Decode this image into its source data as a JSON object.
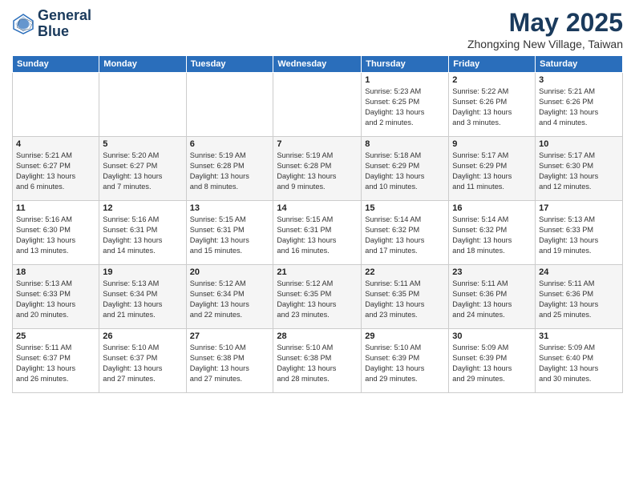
{
  "header": {
    "logo_line1": "General",
    "logo_line2": "Blue",
    "title": "May 2025",
    "subtitle": "Zhongxing New Village, Taiwan"
  },
  "weekdays": [
    "Sunday",
    "Monday",
    "Tuesday",
    "Wednesday",
    "Thursday",
    "Friday",
    "Saturday"
  ],
  "weeks": [
    [
      {
        "day": "",
        "content": ""
      },
      {
        "day": "",
        "content": ""
      },
      {
        "day": "",
        "content": ""
      },
      {
        "day": "",
        "content": ""
      },
      {
        "day": "1",
        "content": "Sunrise: 5:23 AM\nSunset: 6:25 PM\nDaylight: 13 hours\nand 2 minutes."
      },
      {
        "day": "2",
        "content": "Sunrise: 5:22 AM\nSunset: 6:26 PM\nDaylight: 13 hours\nand 3 minutes."
      },
      {
        "day": "3",
        "content": "Sunrise: 5:21 AM\nSunset: 6:26 PM\nDaylight: 13 hours\nand 4 minutes."
      }
    ],
    [
      {
        "day": "4",
        "content": "Sunrise: 5:21 AM\nSunset: 6:27 PM\nDaylight: 13 hours\nand 6 minutes."
      },
      {
        "day": "5",
        "content": "Sunrise: 5:20 AM\nSunset: 6:27 PM\nDaylight: 13 hours\nand 7 minutes."
      },
      {
        "day": "6",
        "content": "Sunrise: 5:19 AM\nSunset: 6:28 PM\nDaylight: 13 hours\nand 8 minutes."
      },
      {
        "day": "7",
        "content": "Sunrise: 5:19 AM\nSunset: 6:28 PM\nDaylight: 13 hours\nand 9 minutes."
      },
      {
        "day": "8",
        "content": "Sunrise: 5:18 AM\nSunset: 6:29 PM\nDaylight: 13 hours\nand 10 minutes."
      },
      {
        "day": "9",
        "content": "Sunrise: 5:17 AM\nSunset: 6:29 PM\nDaylight: 13 hours\nand 11 minutes."
      },
      {
        "day": "10",
        "content": "Sunrise: 5:17 AM\nSunset: 6:30 PM\nDaylight: 13 hours\nand 12 minutes."
      }
    ],
    [
      {
        "day": "11",
        "content": "Sunrise: 5:16 AM\nSunset: 6:30 PM\nDaylight: 13 hours\nand 13 minutes."
      },
      {
        "day": "12",
        "content": "Sunrise: 5:16 AM\nSunset: 6:31 PM\nDaylight: 13 hours\nand 14 minutes."
      },
      {
        "day": "13",
        "content": "Sunrise: 5:15 AM\nSunset: 6:31 PM\nDaylight: 13 hours\nand 15 minutes."
      },
      {
        "day": "14",
        "content": "Sunrise: 5:15 AM\nSunset: 6:31 PM\nDaylight: 13 hours\nand 16 minutes."
      },
      {
        "day": "15",
        "content": "Sunrise: 5:14 AM\nSunset: 6:32 PM\nDaylight: 13 hours\nand 17 minutes."
      },
      {
        "day": "16",
        "content": "Sunrise: 5:14 AM\nSunset: 6:32 PM\nDaylight: 13 hours\nand 18 minutes."
      },
      {
        "day": "17",
        "content": "Sunrise: 5:13 AM\nSunset: 6:33 PM\nDaylight: 13 hours\nand 19 minutes."
      }
    ],
    [
      {
        "day": "18",
        "content": "Sunrise: 5:13 AM\nSunset: 6:33 PM\nDaylight: 13 hours\nand 20 minutes."
      },
      {
        "day": "19",
        "content": "Sunrise: 5:13 AM\nSunset: 6:34 PM\nDaylight: 13 hours\nand 21 minutes."
      },
      {
        "day": "20",
        "content": "Sunrise: 5:12 AM\nSunset: 6:34 PM\nDaylight: 13 hours\nand 22 minutes."
      },
      {
        "day": "21",
        "content": "Sunrise: 5:12 AM\nSunset: 6:35 PM\nDaylight: 13 hours\nand 23 minutes."
      },
      {
        "day": "22",
        "content": "Sunrise: 5:11 AM\nSunset: 6:35 PM\nDaylight: 13 hours\nand 23 minutes."
      },
      {
        "day": "23",
        "content": "Sunrise: 5:11 AM\nSunset: 6:36 PM\nDaylight: 13 hours\nand 24 minutes."
      },
      {
        "day": "24",
        "content": "Sunrise: 5:11 AM\nSunset: 6:36 PM\nDaylight: 13 hours\nand 25 minutes."
      }
    ],
    [
      {
        "day": "25",
        "content": "Sunrise: 5:11 AM\nSunset: 6:37 PM\nDaylight: 13 hours\nand 26 minutes."
      },
      {
        "day": "26",
        "content": "Sunrise: 5:10 AM\nSunset: 6:37 PM\nDaylight: 13 hours\nand 27 minutes."
      },
      {
        "day": "27",
        "content": "Sunrise: 5:10 AM\nSunset: 6:38 PM\nDaylight: 13 hours\nand 27 minutes."
      },
      {
        "day": "28",
        "content": "Sunrise: 5:10 AM\nSunset: 6:38 PM\nDaylight: 13 hours\nand 28 minutes."
      },
      {
        "day": "29",
        "content": "Sunrise: 5:10 AM\nSunset: 6:39 PM\nDaylight: 13 hours\nand 29 minutes."
      },
      {
        "day": "30",
        "content": "Sunrise: 5:09 AM\nSunset: 6:39 PM\nDaylight: 13 hours\nand 29 minutes."
      },
      {
        "day": "31",
        "content": "Sunrise: 5:09 AM\nSunset: 6:40 PM\nDaylight: 13 hours\nand 30 minutes."
      }
    ]
  ]
}
